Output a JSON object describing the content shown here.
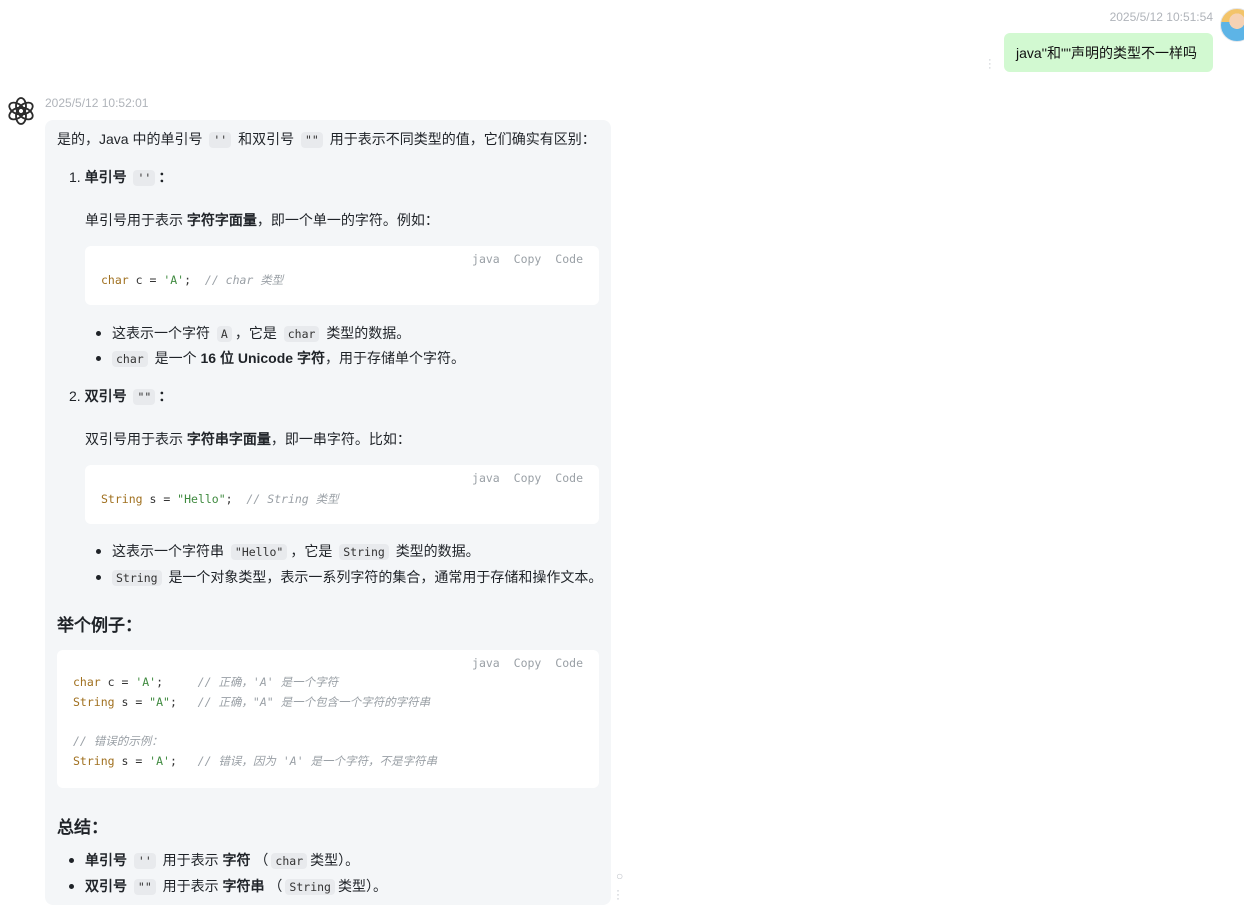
{
  "user": {
    "timestamp": "2025/5/12 10:51:54",
    "message": "java''和\"\"声明的类型不一样吗"
  },
  "bot": {
    "timestamp": "2025/5/12 10:52:01",
    "intro": {
      "a": "是的，Java 中的单引号",
      "code1": "''",
      "b": "和双引号",
      "code2": "\"\"",
      "c": "用于表示不同类型的值，它们确实有区别："
    },
    "section1": {
      "num": "1.",
      "title": "单引号",
      "code": "''",
      "colon": "：",
      "desc_a": "单引号用于表示",
      "desc_bold": "字符字面量",
      "desc_b": "，即一个单一的字符。例如：",
      "code_lang": "java",
      "copy_label": "Copy",
      "code_label": "Code",
      "code_line": {
        "kw": "char",
        "mid": " c = ",
        "str": "'A'",
        "end": ";  ",
        "cmt": "// char 类型"
      },
      "bullet1": {
        "a": "这表示一个字符",
        "code1": "A",
        "b": "，它是",
        "code2": "char",
        "c": "类型的数据。"
      },
      "bullet2": {
        "code": "char",
        "a": "是一个",
        "bold": "16 位 Unicode 字符",
        "b": "，用于存储单个字符。"
      }
    },
    "section2": {
      "num": "2.",
      "title": "双引号",
      "code": "\"\"",
      "colon": "：",
      "desc_a": "双引号用于表示",
      "desc_bold": "字符串字面量",
      "desc_b": "，即一串字符。比如：",
      "code_lang": "java",
      "copy_label": "Copy",
      "code_label": "Code",
      "code_line": {
        "kw": "String",
        "mid": " s = ",
        "str": "\"Hello\"",
        "end": ";  ",
        "cmt": "// String 类型"
      },
      "bullet1": {
        "a": "这表示一个字符串",
        "code1": "\"Hello\"",
        "b": "，它是",
        "code2": "String",
        "c": "类型的数据。"
      },
      "bullet2": {
        "code": "String",
        "a": "是一个对象类型，表示一系列字符的集合，通常用于存储和操作文本。"
      }
    },
    "example": {
      "heading": "举个例子：",
      "code_lang": "java",
      "copy_label": "Copy",
      "code_label": "Code",
      "line1": {
        "kw": "char",
        "mid": " c = ",
        "str": "'A'",
        "end": ";     ",
        "cmt": "// 正确，'A' 是一个字符"
      },
      "line2": {
        "kw": "String",
        "mid": " s = ",
        "str": "\"A\"",
        "end": ";   ",
        "cmt": "// 正确，\"A\" 是一个包含一个字符的字符串"
      },
      "line3": {
        "cmt": "// 错误的示例："
      },
      "line4": {
        "kw": "String",
        "mid": " s = ",
        "str": "'A'",
        "end": ";   ",
        "cmt": "// 错误，因为 'A' 是一个字符，不是字符串"
      }
    },
    "summary": {
      "heading": "总结：",
      "item1": {
        "bold1": "单引号",
        "code1": "''",
        "a": "用于表示",
        "bold2": "字符",
        "b": "（",
        "code2": "char",
        "c": "类型）。"
      },
      "item2": {
        "bold1": "双引号",
        "code1": "\"\"",
        "a": "用于表示",
        "bold2": "字符串",
        "b": "（",
        "code2": "String",
        "c": "类型）。"
      }
    }
  }
}
